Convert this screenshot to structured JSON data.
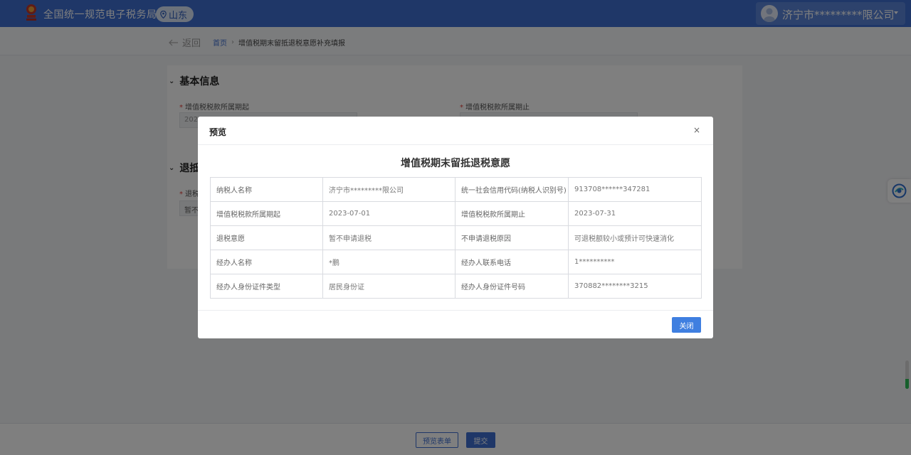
{
  "header": {
    "brand": "全国统一规范电子税务局",
    "region": "山东",
    "user_name": "济宁市*********限公司"
  },
  "subbar": {
    "back_label": "返回",
    "breadcrumb_home": "首页",
    "breadcrumb_sep": "›",
    "breadcrumb_current": "增值税期末留抵退税意愿补充填报"
  },
  "form": {
    "section_basic": "基本信息",
    "label_start": "增值税税款所属期起",
    "label_end": "增值税税款所属期止",
    "value_start": "2023",
    "section_refund": "退抵",
    "label_refund": "退税",
    "value_refund": "暂不"
  },
  "bottom": {
    "preview_label": "预览表单",
    "submit_label": "提交"
  },
  "modal": {
    "title": "预览",
    "close_symbol": "×",
    "doc_title": "增值税期末留抵退税意愿",
    "rows": [
      [
        "纳税人名称",
        "济宁市*********限公司",
        "统一社会信用代码(纳税人识别号)",
        "913708******347281"
      ],
      [
        "增值税税款所属期起",
        "2023-07-01",
        "增值税税款所属期止",
        "2023-07-31"
      ],
      [
        "退税意愿",
        "暂不申请退税",
        "不申请退税原因",
        "可退税额较小或预计可快速消化"
      ],
      [
        "经办人名称",
        "*鹏",
        "经办人联系电话",
        "1**********"
      ],
      [
        "经办人身份证件类型",
        "居民身份证",
        "经办人身份证件号码",
        "370882********3215"
      ]
    ],
    "close_label": "关闭"
  },
  "colors": {
    "header_bg": "#3f6fd1",
    "primary": "#3f7fe0"
  }
}
